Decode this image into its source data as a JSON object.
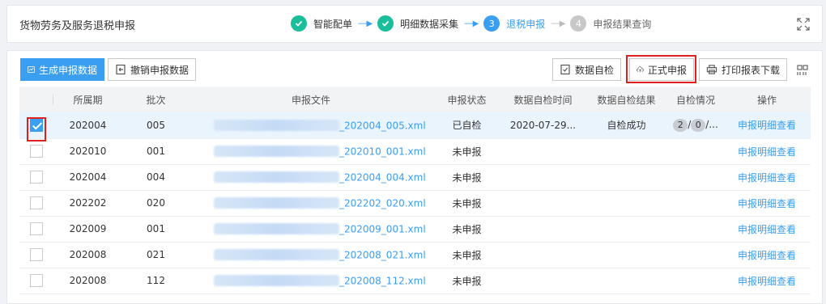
{
  "header": {
    "title": "货物劳务及服务退税申报",
    "steps": [
      {
        "label": "智能配单",
        "state": "done",
        "num": ""
      },
      {
        "label": "明细数据采集",
        "state": "done",
        "num": ""
      },
      {
        "label": "退税申报",
        "state": "active",
        "num": "3"
      },
      {
        "label": "申报结果查询",
        "state": "todo",
        "num": "4"
      }
    ],
    "arrow": "----▶"
  },
  "toolbar": {
    "generate_label": "生成申报数据",
    "revoke_label": "撤销申报数据",
    "self_check_label": "数据自检",
    "formal_declare_label": "正式申报",
    "print_label": "打印报表下载"
  },
  "table": {
    "columns": [
      "所属期",
      "批次",
      "申报文件",
      "申报状态",
      "数据自检时间",
      "数据自检结果",
      "自检情况",
      "操作"
    ],
    "rows": [
      {
        "checked": true,
        "period": "202004",
        "batch": "005",
        "file": "_202004_005.xml",
        "status": "已自检",
        "check_time": "2020-07-29...",
        "check_result": "自检成功",
        "pill1": "2",
        "sep": "/",
        "pill2": "0",
        "ellipsis": "/...",
        "op": "申报明细查看"
      },
      {
        "checked": false,
        "period": "202010",
        "batch": "001",
        "file": "_202010_001.xml",
        "status": "未申报",
        "check_time": "",
        "check_result": "",
        "op": "申报明细查看"
      },
      {
        "checked": false,
        "period": "202004",
        "batch": "004",
        "file": "_202004_004.xml",
        "status": "未申报",
        "check_time": "",
        "check_result": "",
        "op": "申报明细查看"
      },
      {
        "checked": false,
        "period": "202202",
        "batch": "020",
        "file": "_202202_020.xml",
        "status": "未申报",
        "check_time": "",
        "check_result": "",
        "op": "申报明细查看"
      },
      {
        "checked": false,
        "period": "202009",
        "batch": "001",
        "file": "_202009_001.xml",
        "status": "未申报",
        "check_time": "",
        "check_result": "",
        "op": "申报明细查看"
      },
      {
        "checked": false,
        "period": "202008",
        "batch": "021",
        "file": "_202008_021.xml",
        "status": "未申报",
        "check_time": "",
        "check_result": "",
        "op": "申报明细查看"
      },
      {
        "checked": false,
        "period": "202008",
        "batch": "112",
        "file": "_202008_112.xml",
        "status": "未申报",
        "check_time": "",
        "check_result": "",
        "op": "申报明细查看"
      }
    ]
  },
  "colors": {
    "accent": "#3a9ef1",
    "done": "#1bbe9a",
    "highlight": "#e02020"
  }
}
